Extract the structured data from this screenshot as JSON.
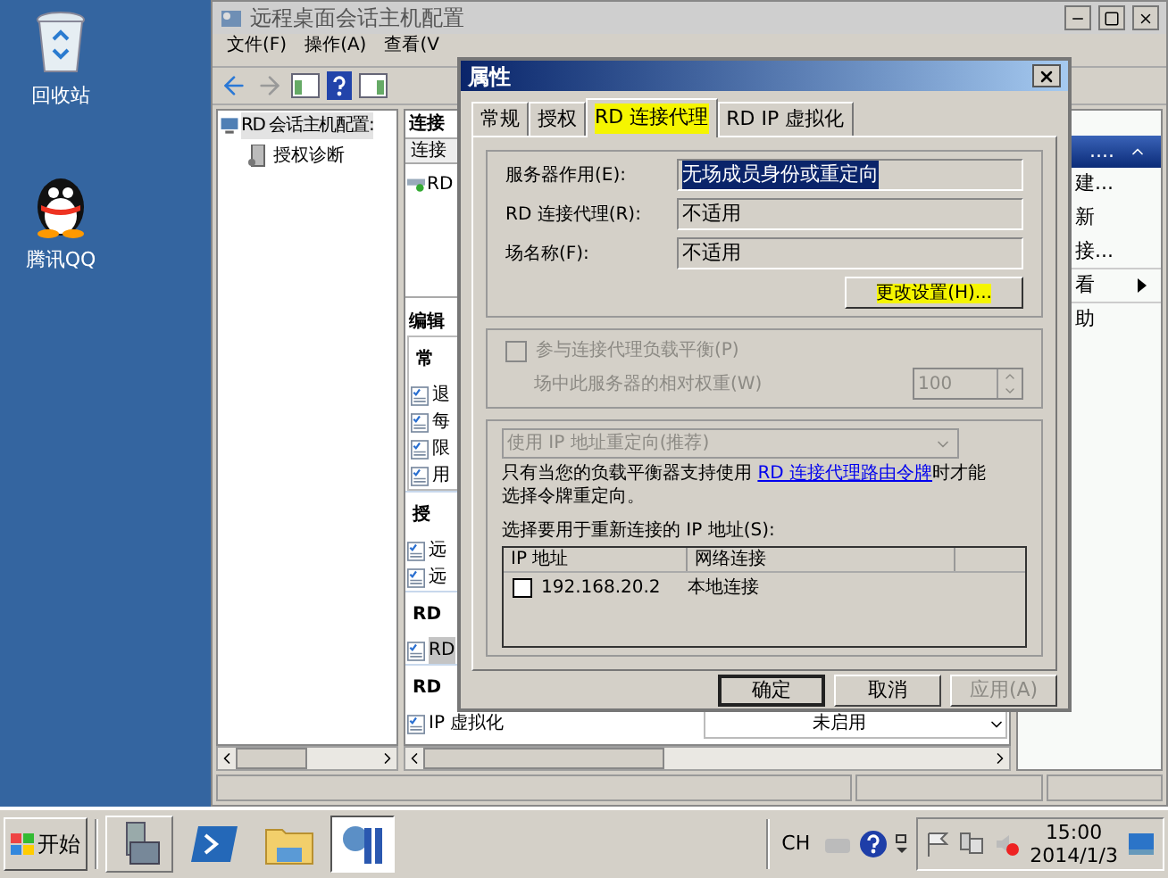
{
  "desktop_icons": [
    {
      "kind": "recycle_bin",
      "label": "回收站"
    },
    {
      "kind": "qq",
      "label": "腾讯QQ"
    }
  ],
  "main_window": {
    "title": "远程桌面会话主机配置",
    "menu": [
      "文件(F)",
      "操作(A)",
      "查看(V"
    ],
    "tree": [
      {
        "label": "RD 会话主机配置:",
        "selected": true,
        "children": [
          {
            "label": "授权诊断",
            "selected": false
          }
        ]
      }
    ],
    "connections": {
      "title": "连接",
      "column_1": "连接",
      "rows": [
        {
          "label": "RD"
        }
      ]
    },
    "settings": {
      "title": "编辑",
      "sections": [
        {
          "heading": "常",
          "items": [
            {
              "label": "退",
              "selected": false
            },
            {
              "label": "每",
              "selected": false
            },
            {
              "label": "限",
              "selected": false
            },
            {
              "label": "用",
              "selected": false
            }
          ]
        },
        {
          "heading": "授",
          "items": [
            {
              "label": "远",
              "selected": false
            },
            {
              "label": "远",
              "selected": false
            }
          ]
        },
        {
          "heading": "RD",
          "items": [
            {
              "label": "RD",
              "selected": true
            }
          ]
        },
        {
          "heading": "RD",
          "items": [
            {
              "label": "IP 虚拟化",
              "value": "未启用",
              "selected": false
            }
          ]
        }
      ]
    },
    "actions": {
      "header": "....",
      "items": [
        {
          "label": "建...",
          "submenu": false,
          "separator_after": false
        },
        {
          "label": "新",
          "submenu": false,
          "separator_after": false
        },
        {
          "label": "接...",
          "submenu": false,
          "separator_after": true
        },
        {
          "label": "看",
          "submenu": true,
          "separator_after": true
        },
        {
          "label": "助",
          "submenu": false,
          "separator_after": false
        }
      ]
    }
  },
  "dialog": {
    "title": "属性",
    "tabs": [
      {
        "label": "常规",
        "selected": false,
        "highlighted": false
      },
      {
        "label": "授权",
        "selected": false,
        "highlighted": false
      },
      {
        "label": "RD 连接代理",
        "selected": true,
        "highlighted": true
      },
      {
        "label": "RD IP 虚拟化",
        "selected": false,
        "highlighted": false
      }
    ],
    "fields": [
      {
        "label": "服务器作用(E):",
        "value": "无场成员身份或重定向",
        "text_selected": true
      },
      {
        "label": "RD 连接代理(R):",
        "value": "不适用",
        "text_selected": false
      },
      {
        "label": "场名称(F):",
        "value": "不适用",
        "text_selected": false
      }
    ],
    "change_button": {
      "label": "更改设置(H)...",
      "highlighted": true
    },
    "load_balancing": {
      "label": "参与连接代理负载平衡(P)",
      "checked": false,
      "disabled": true,
      "weight_label": "场中此服务器的相对权重(W)",
      "weight_value": "100"
    },
    "redirection": {
      "dropdown": "使用 IP 地址重定向(推荐)",
      "disabled": true,
      "note": {
        "before": "只有当您的负载平衡器支持使用 ",
        "link": "RD 连接代理路由令牌",
        "after": "时才能选择令牌重定向。"
      },
      "list_label": "选择要用于重新连接的 IP 地址(S):",
      "columns": [
        "IP 地址",
        "网络连接"
      ],
      "rows": [
        {
          "ip": "192.168.20.2",
          "connection": "本地连接",
          "checked": false
        }
      ]
    },
    "buttons": [
      {
        "label": "确定",
        "default": true,
        "disabled": false
      },
      {
        "label": "取消",
        "default": false,
        "disabled": false
      },
      {
        "label": "应用(A)",
        "default": false,
        "disabled": true
      }
    ]
  },
  "taskbar": {
    "start": "开始",
    "quick_launch": [
      {
        "kind": "server_manager"
      },
      {
        "kind": "powershell"
      },
      {
        "kind": "explorer"
      }
    ],
    "tasks": [
      {
        "kind": "rd_config",
        "active": true
      }
    ],
    "language": "CH",
    "time": "15:00",
    "date": "2014/1/3"
  }
}
